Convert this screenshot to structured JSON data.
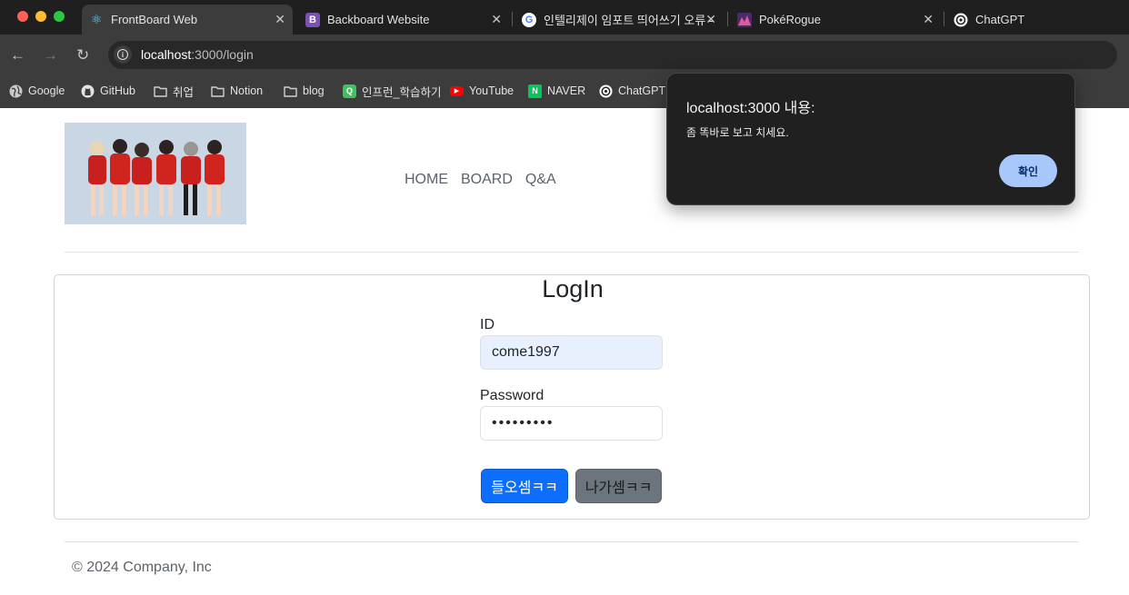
{
  "browser": {
    "tabs": [
      {
        "title": "FrontBoard Web",
        "icon": "react-icon",
        "active": true
      },
      {
        "title": "Backboard Website",
        "icon": "bootstrap-icon",
        "active": false
      },
      {
        "title": "인텔리제이 임포트 띄어쓰기 오류 -",
        "icon": "google-icon",
        "active": false
      },
      {
        "title": "PokéRogue",
        "icon": "pokerogue-icon",
        "active": false
      },
      {
        "title": "ChatGPT",
        "icon": "chatgpt-icon",
        "active": false
      }
    ],
    "close_glyph": "✕",
    "nav": {
      "back": "←",
      "forward": "→",
      "reload": "↻"
    },
    "url": {
      "host": "localhost",
      "rest": ":3000/login"
    },
    "site_info_glyph": "i",
    "bookmarks": [
      {
        "label": "Google",
        "icon": "globe-icon"
      },
      {
        "label": "GitHub",
        "icon": "github-icon"
      },
      {
        "label": "취업",
        "icon": "folder-icon"
      },
      {
        "label": "Notion",
        "icon": "folder-icon"
      },
      {
        "label": "blog",
        "icon": "folder-icon"
      },
      {
        "label": "인프런_학습하기",
        "icon": "inflearn-icon"
      },
      {
        "label": "YouTube",
        "icon": "youtube-icon"
      },
      {
        "label": "NAVER",
        "icon": "naver-icon"
      },
      {
        "label": "ChatGPT",
        "icon": "chatgpt-icon"
      }
    ],
    "bookmark_glyphs": {
      "react": "⚛",
      "bootstrap": "B",
      "google": "G",
      "naver": "N",
      "inflearn": "Q",
      "youtube": "▶"
    }
  },
  "page": {
    "nav": {
      "home": "HOME",
      "board": "BOARD",
      "qa": "Q&A"
    },
    "login": {
      "title": "LogIn",
      "id_label": "ID",
      "id_value": "come1997",
      "password_label": "Password",
      "password_value": "•••••••••",
      "submit_label": "들오셈ㅋㅋ",
      "exit_label": "나가셈ㅋㅋ"
    },
    "footer": "© 2024 Company, Inc"
  },
  "alert": {
    "title": "localhost:3000 내용:",
    "message": "좀 똑바로 보고 치세요.",
    "ok_label": "확인"
  },
  "colors": {
    "primary": "#0d6efd",
    "secondary": "#6c757d",
    "autofill": "#e8f0fe",
    "alert_bg": "#202020",
    "alert_ok": "#a8c7fa"
  }
}
